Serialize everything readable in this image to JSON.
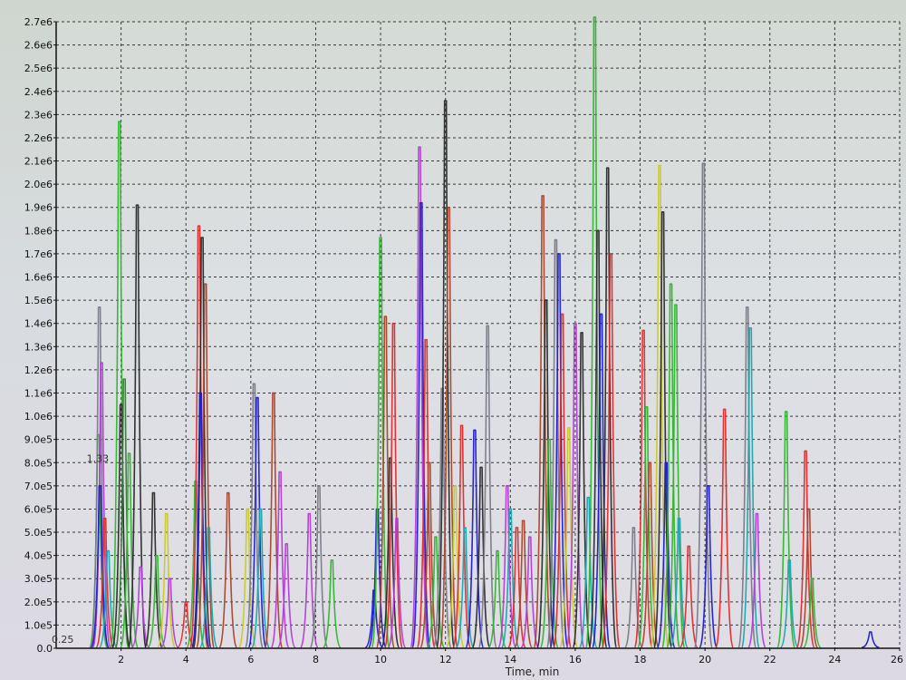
{
  "chart_data": {
    "type": "line",
    "title": "",
    "xlabel": "Time, min",
    "ylabel": "",
    "xlim": [
      0,
      26
    ],
    "ylim": [
      0,
      2700000
    ],
    "grid": true,
    "x_ticks": [
      {
        "value": 2,
        "label": "2"
      },
      {
        "value": 4,
        "label": "4"
      },
      {
        "value": 6,
        "label": "6"
      },
      {
        "value": 8,
        "label": "8"
      },
      {
        "value": 10,
        "label": "10"
      },
      {
        "value": 12,
        "label": "12"
      },
      {
        "value": 14,
        "label": "14"
      },
      {
        "value": 16,
        "label": "16"
      },
      {
        "value": 18,
        "label": "18"
      },
      {
        "value": 20,
        "label": "20"
      },
      {
        "value": 22,
        "label": "22"
      },
      {
        "value": 24,
        "label": "24"
      },
      {
        "value": 26,
        "label": "26"
      }
    ],
    "y_ticks": [
      {
        "value": 0,
        "label": "0.0"
      },
      {
        "value": 100000,
        "label": "1.0e5"
      },
      {
        "value": 200000,
        "label": "2.0e5"
      },
      {
        "value": 300000,
        "label": "3.0e5"
      },
      {
        "value": 400000,
        "label": "4.0e5"
      },
      {
        "value": 500000,
        "label": "5.0e5"
      },
      {
        "value": 600000,
        "label": "6.0e5"
      },
      {
        "value": 700000,
        "label": "7.0e5"
      },
      {
        "value": 800000,
        "label": "8.0e5"
      },
      {
        "value": 900000,
        "label": "9.0e5"
      },
      {
        "value": 1000000,
        "label": "1.0e6"
      },
      {
        "value": 1100000,
        "label": "1.1e6"
      },
      {
        "value": 1200000,
        "label": "1.2e6"
      },
      {
        "value": 1300000,
        "label": "1.3e6"
      },
      {
        "value": 1400000,
        "label": "1.4e6"
      },
      {
        "value": 1500000,
        "label": "1.5e6"
      },
      {
        "value": 1600000,
        "label": "1.6e6"
      },
      {
        "value": 1700000,
        "label": "1.7e6"
      },
      {
        "value": 1800000,
        "label": "1.8e6"
      },
      {
        "value": 1900000,
        "label": "1.9e6"
      },
      {
        "value": 2000000,
        "label": "2.0e6"
      },
      {
        "value": 2100000,
        "label": "2.1e6"
      },
      {
        "value": 2200000,
        "label": "2.2e6"
      },
      {
        "value": 2300000,
        "label": "2.3e6"
      },
      {
        "value": 2400000,
        "label": "2.4e6"
      },
      {
        "value": 2500000,
        "label": "2.5e6"
      },
      {
        "value": 2600000,
        "label": "2.6e6"
      },
      {
        "value": 2700000,
        "label": "2.7e6"
      }
    ],
    "annotations": [
      {
        "text": "1.33",
        "x": 1.33,
        "y": 780000
      },
      {
        "text": "0.25",
        "x": 0.25,
        "y": 0
      }
    ],
    "series_colors": [
      "#1c1cd0",
      "#2fb52f",
      "#e02a2a",
      "#b23cd6",
      "#7a7a8a",
      "#2a2a2a",
      "#19a7b0",
      "#a8442a",
      "#c9c92a",
      "#3a7a3a"
    ],
    "peaks": [
      {
        "x": 1.3,
        "y": 920000,
        "color": "#2fb52f"
      },
      {
        "x": 1.33,
        "y": 1470000,
        "color": "#7a7a8a"
      },
      {
        "x": 1.4,
        "y": 1230000,
        "color": "#b23cd6"
      },
      {
        "x": 1.35,
        "y": 700000,
        "color": "#1c1cd0"
      },
      {
        "x": 1.5,
        "y": 560000,
        "color": "#e02a2a"
      },
      {
        "x": 1.6,
        "y": 420000,
        "color": "#19a7b0"
      },
      {
        "x": 1.95,
        "y": 2270000,
        "color": "#2fb52f"
      },
      {
        "x": 2.0,
        "y": 1050000,
        "color": "#2a2a2a"
      },
      {
        "x": 2.1,
        "y": 1160000,
        "color": "#3a7a3a"
      },
      {
        "x": 2.25,
        "y": 840000,
        "color": "#2fb52f"
      },
      {
        "x": 2.5,
        "y": 1910000,
        "color": "#2a2a2a"
      },
      {
        "x": 2.6,
        "y": 350000,
        "color": "#b23cd6"
      },
      {
        "x": 3.0,
        "y": 670000,
        "color": "#2a2a2a"
      },
      {
        "x": 3.1,
        "y": 400000,
        "color": "#2fb52f"
      },
      {
        "x": 3.4,
        "y": 580000,
        "color": "#c9c92a"
      },
      {
        "x": 3.5,
        "y": 300000,
        "color": "#b23cd6"
      },
      {
        "x": 4.0,
        "y": 200000,
        "color": "#e02a2a"
      },
      {
        "x": 4.3,
        "y": 720000,
        "color": "#2fb52f"
      },
      {
        "x": 4.4,
        "y": 1820000,
        "color": "#e02a2a"
      },
      {
        "x": 4.5,
        "y": 1770000,
        "color": "#2a2a2a"
      },
      {
        "x": 4.45,
        "y": 1100000,
        "color": "#1c1cd0"
      },
      {
        "x": 4.6,
        "y": 1570000,
        "color": "#a8442a"
      },
      {
        "x": 4.7,
        "y": 520000,
        "color": "#19a7b0"
      },
      {
        "x": 5.3,
        "y": 670000,
        "color": "#a8442a"
      },
      {
        "x": 5.9,
        "y": 600000,
        "color": "#c9c92a"
      },
      {
        "x": 6.1,
        "y": 1140000,
        "color": "#7a7a8a"
      },
      {
        "x": 6.2,
        "y": 1080000,
        "color": "#1c1cd0"
      },
      {
        "x": 6.3,
        "y": 600000,
        "color": "#19a7b0"
      },
      {
        "x": 6.7,
        "y": 1100000,
        "color": "#a8442a"
      },
      {
        "x": 6.9,
        "y": 760000,
        "color": "#b23cd6"
      },
      {
        "x": 7.1,
        "y": 450000,
        "color": "#b23cd6"
      },
      {
        "x": 7.8,
        "y": 580000,
        "color": "#b23cd6"
      },
      {
        "x": 8.1,
        "y": 700000,
        "color": "#7a7a8a"
      },
      {
        "x": 8.5,
        "y": 380000,
        "color": "#2fb52f"
      },
      {
        "x": 9.8,
        "y": 250000,
        "color": "#1c1cd0"
      },
      {
        "x": 9.9,
        "y": 600000,
        "color": "#1c1cd0"
      },
      {
        "x": 10.0,
        "y": 1770000,
        "color": "#2fb52f"
      },
      {
        "x": 10.15,
        "y": 1430000,
        "color": "#a8442a"
      },
      {
        "x": 10.3,
        "y": 820000,
        "color": "#2a2a2a"
      },
      {
        "x": 10.4,
        "y": 1400000,
        "color": "#e02a2a"
      },
      {
        "x": 10.5,
        "y": 560000,
        "color": "#b23cd6"
      },
      {
        "x": 11.2,
        "y": 2160000,
        "color": "#b23cd6"
      },
      {
        "x": 11.25,
        "y": 1920000,
        "color": "#1c1cd0"
      },
      {
        "x": 11.4,
        "y": 1330000,
        "color": "#e02a2a"
      },
      {
        "x": 11.5,
        "y": 800000,
        "color": "#a8442a"
      },
      {
        "x": 11.7,
        "y": 480000,
        "color": "#2fb52f"
      },
      {
        "x": 11.9,
        "y": 1120000,
        "color": "#7a7a8a"
      },
      {
        "x": 12.0,
        "y": 2360000,
        "color": "#2a2a2a"
      },
      {
        "x": 12.1,
        "y": 1900000,
        "color": "#a8442a"
      },
      {
        "x": 12.3,
        "y": 700000,
        "color": "#c9c92a"
      },
      {
        "x": 12.5,
        "y": 960000,
        "color": "#e02a2a"
      },
      {
        "x": 12.6,
        "y": 520000,
        "color": "#19a7b0"
      },
      {
        "x": 12.9,
        "y": 940000,
        "color": "#1c1cd0"
      },
      {
        "x": 13.1,
        "y": 780000,
        "color": "#2a2a2a"
      },
      {
        "x": 13.3,
        "y": 1390000,
        "color": "#7a7a8a"
      },
      {
        "x": 13.6,
        "y": 420000,
        "color": "#2fb52f"
      },
      {
        "x": 13.9,
        "y": 700000,
        "color": "#b23cd6"
      },
      {
        "x": 14.0,
        "y": 600000,
        "color": "#19a7b0"
      },
      {
        "x": 14.2,
        "y": 520000,
        "color": "#e02a2a"
      },
      {
        "x": 14.4,
        "y": 550000,
        "color": "#a8442a"
      },
      {
        "x": 14.6,
        "y": 480000,
        "color": "#b23cd6"
      },
      {
        "x": 15.0,
        "y": 1950000,
        "color": "#a8442a"
      },
      {
        "x": 15.1,
        "y": 1500000,
        "color": "#2a2a2a"
      },
      {
        "x": 15.2,
        "y": 900000,
        "color": "#2fb52f"
      },
      {
        "x": 15.4,
        "y": 1760000,
        "color": "#7a7a8a"
      },
      {
        "x": 15.5,
        "y": 1700000,
        "color": "#1c1cd0"
      },
      {
        "x": 15.6,
        "y": 1440000,
        "color": "#e02a2a"
      },
      {
        "x": 15.8,
        "y": 950000,
        "color": "#c9c92a"
      },
      {
        "x": 16.0,
        "y": 1400000,
        "color": "#b23cd6"
      },
      {
        "x": 16.2,
        "y": 1360000,
        "color": "#2a2a2a"
      },
      {
        "x": 16.4,
        "y": 650000,
        "color": "#19a7b0"
      },
      {
        "x": 16.6,
        "y": 2720000,
        "color": "#2fb52f"
      },
      {
        "x": 16.7,
        "y": 1800000,
        "color": "#2a2a2a"
      },
      {
        "x": 16.8,
        "y": 1440000,
        "color": "#1c1cd0"
      },
      {
        "x": 17.0,
        "y": 2070000,
        "color": "#2a2a2a"
      },
      {
        "x": 17.1,
        "y": 1700000,
        "color": "#e02a2a"
      },
      {
        "x": 17.8,
        "y": 520000,
        "color": "#7a7a8a"
      },
      {
        "x": 18.1,
        "y": 1370000,
        "color": "#e02a2a"
      },
      {
        "x": 18.2,
        "y": 1040000,
        "color": "#2fb52f"
      },
      {
        "x": 18.3,
        "y": 800000,
        "color": "#a8442a"
      },
      {
        "x": 18.6,
        "y": 2080000,
        "color": "#c9c92a"
      },
      {
        "x": 18.7,
        "y": 1880000,
        "color": "#2a2a2a"
      },
      {
        "x": 18.8,
        "y": 800000,
        "color": "#1c1cd0"
      },
      {
        "x": 18.95,
        "y": 1570000,
        "color": "#2fb52f"
      },
      {
        "x": 19.1,
        "y": 1480000,
        "color": "#2fb52f"
      },
      {
        "x": 19.2,
        "y": 560000,
        "color": "#19a7b0"
      },
      {
        "x": 19.5,
        "y": 440000,
        "color": "#e02a2a"
      },
      {
        "x": 19.95,
        "y": 2090000,
        "color": "#7a7a8a"
      },
      {
        "x": 20.1,
        "y": 700000,
        "color": "#1c1cd0"
      },
      {
        "x": 20.6,
        "y": 1030000,
        "color": "#e02a2a"
      },
      {
        "x": 21.3,
        "y": 1470000,
        "color": "#7a7a8a"
      },
      {
        "x": 21.4,
        "y": 1380000,
        "color": "#19a7b0"
      },
      {
        "x": 21.6,
        "y": 580000,
        "color": "#b23cd6"
      },
      {
        "x": 22.5,
        "y": 1020000,
        "color": "#2fb52f"
      },
      {
        "x": 22.6,
        "y": 380000,
        "color": "#19a7b0"
      },
      {
        "x": 23.1,
        "y": 850000,
        "color": "#e02a2a"
      },
      {
        "x": 23.2,
        "y": 600000,
        "color": "#a8442a"
      },
      {
        "x": 23.3,
        "y": 300000,
        "color": "#2fb52f"
      },
      {
        "x": 25.1,
        "y": 70000,
        "color": "#1c1cd0"
      }
    ]
  }
}
